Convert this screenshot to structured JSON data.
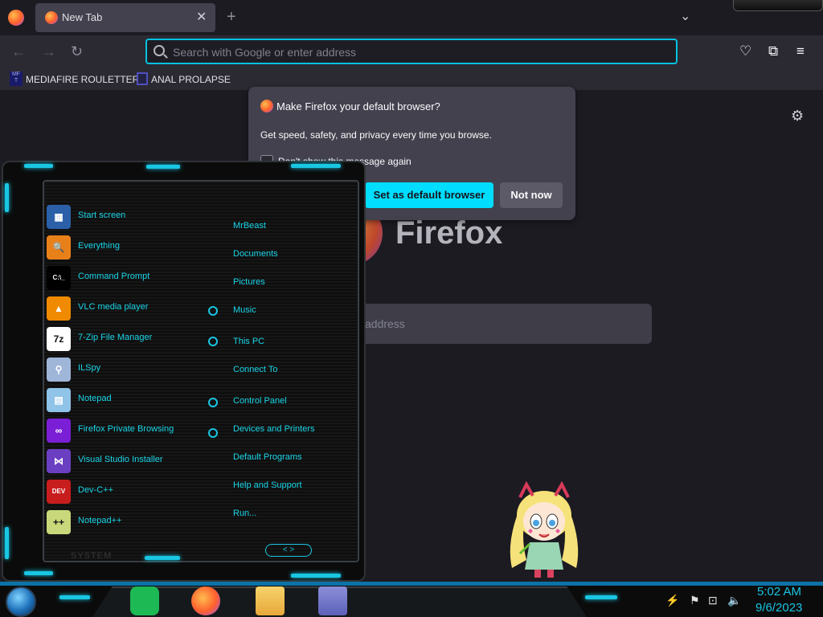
{
  "browser": {
    "tab_title": "New Tab",
    "tab_close": "✕",
    "new_tab": "+",
    "tab_list": "⌄",
    "url_placeholder": "Search with Google or enter address",
    "bookmarks": [
      "MEDIAFIRE ROULETTER",
      "ANAL PROLAPSE"
    ],
    "bookmark1_icon_text": "MF T",
    "nav": {
      "back": "←",
      "forward": "→",
      "reload": "↻"
    },
    "toolbar": {
      "pocket": "♡",
      "extensions": "⧉",
      "menu": "≡"
    }
  },
  "newtab": {
    "brand": "Firefox",
    "search_placeholder": "address",
    "settings_icon": "⚙"
  },
  "popup": {
    "title": "Make Firefox your default browser?",
    "body": "Get speed, safety, and privacy every time you browse.",
    "checkbox_label": "Don't show this message again",
    "primary_button": "Set as default browser",
    "secondary_button": "Not now"
  },
  "startmenu": {
    "apps": [
      {
        "label": "Start screen",
        "icon": "start-screen-icon",
        "color": "#2b5fa8",
        "glyph": "▦"
      },
      {
        "label": "Everything",
        "icon": "magnifier-icon",
        "color": "#e8801a",
        "glyph": "🔍"
      },
      {
        "label": "Command Prompt",
        "icon": "cmd-icon",
        "color": "#000000",
        "glyph": "C:\\_"
      },
      {
        "label": "VLC media player",
        "icon": "vlc-cone-icon",
        "color": "#f08a00",
        "glyph": "▲"
      },
      {
        "label": "7-Zip File Manager",
        "icon": "7zip-icon",
        "color": "#ffffff",
        "glyph": "7z"
      },
      {
        "label": "ILSpy",
        "icon": "ilspy-icon",
        "color": "#9fb6d8",
        "glyph": "⚲"
      },
      {
        "label": "Notepad",
        "icon": "notepad-icon",
        "color": "#8fc3e8",
        "glyph": "▤"
      },
      {
        "label": "Firefox Private Browsing",
        "icon": "private-browsing-icon",
        "color": "#7b1fd6",
        "glyph": "∞"
      },
      {
        "label": "Visual Studio Installer",
        "icon": "vs-installer-icon",
        "color": "#6b3fc2",
        "glyph": "⋈"
      },
      {
        "label": "Dev-C++",
        "icon": "devcpp-icon",
        "color": "#c81d1d",
        "glyph": "DEV C++"
      },
      {
        "label": "Notepad++",
        "icon": "notepadpp-icon",
        "color": "#c8d87a",
        "glyph": "++"
      }
    ],
    "places": [
      "MrBeast",
      "Documents",
      "Pictures",
      "Music",
      "This PC",
      "Connect To",
      "Control Panel",
      "Devices and Printers",
      "Default Programs",
      "Help and Support",
      "Run..."
    ],
    "system_label": "SYSTEM",
    "page_arrows": "< >"
  },
  "taskbar": {
    "time": "5:02 AM",
    "date": "9/6/2023",
    "tray": {
      "flag": "⚑",
      "network": "⊡",
      "volume": "🔈",
      "app": "⚡"
    },
    "apps": [
      "spotify-icon",
      "firefox-icon",
      "file-explorer-icon",
      "window-switcher-icon"
    ]
  }
}
